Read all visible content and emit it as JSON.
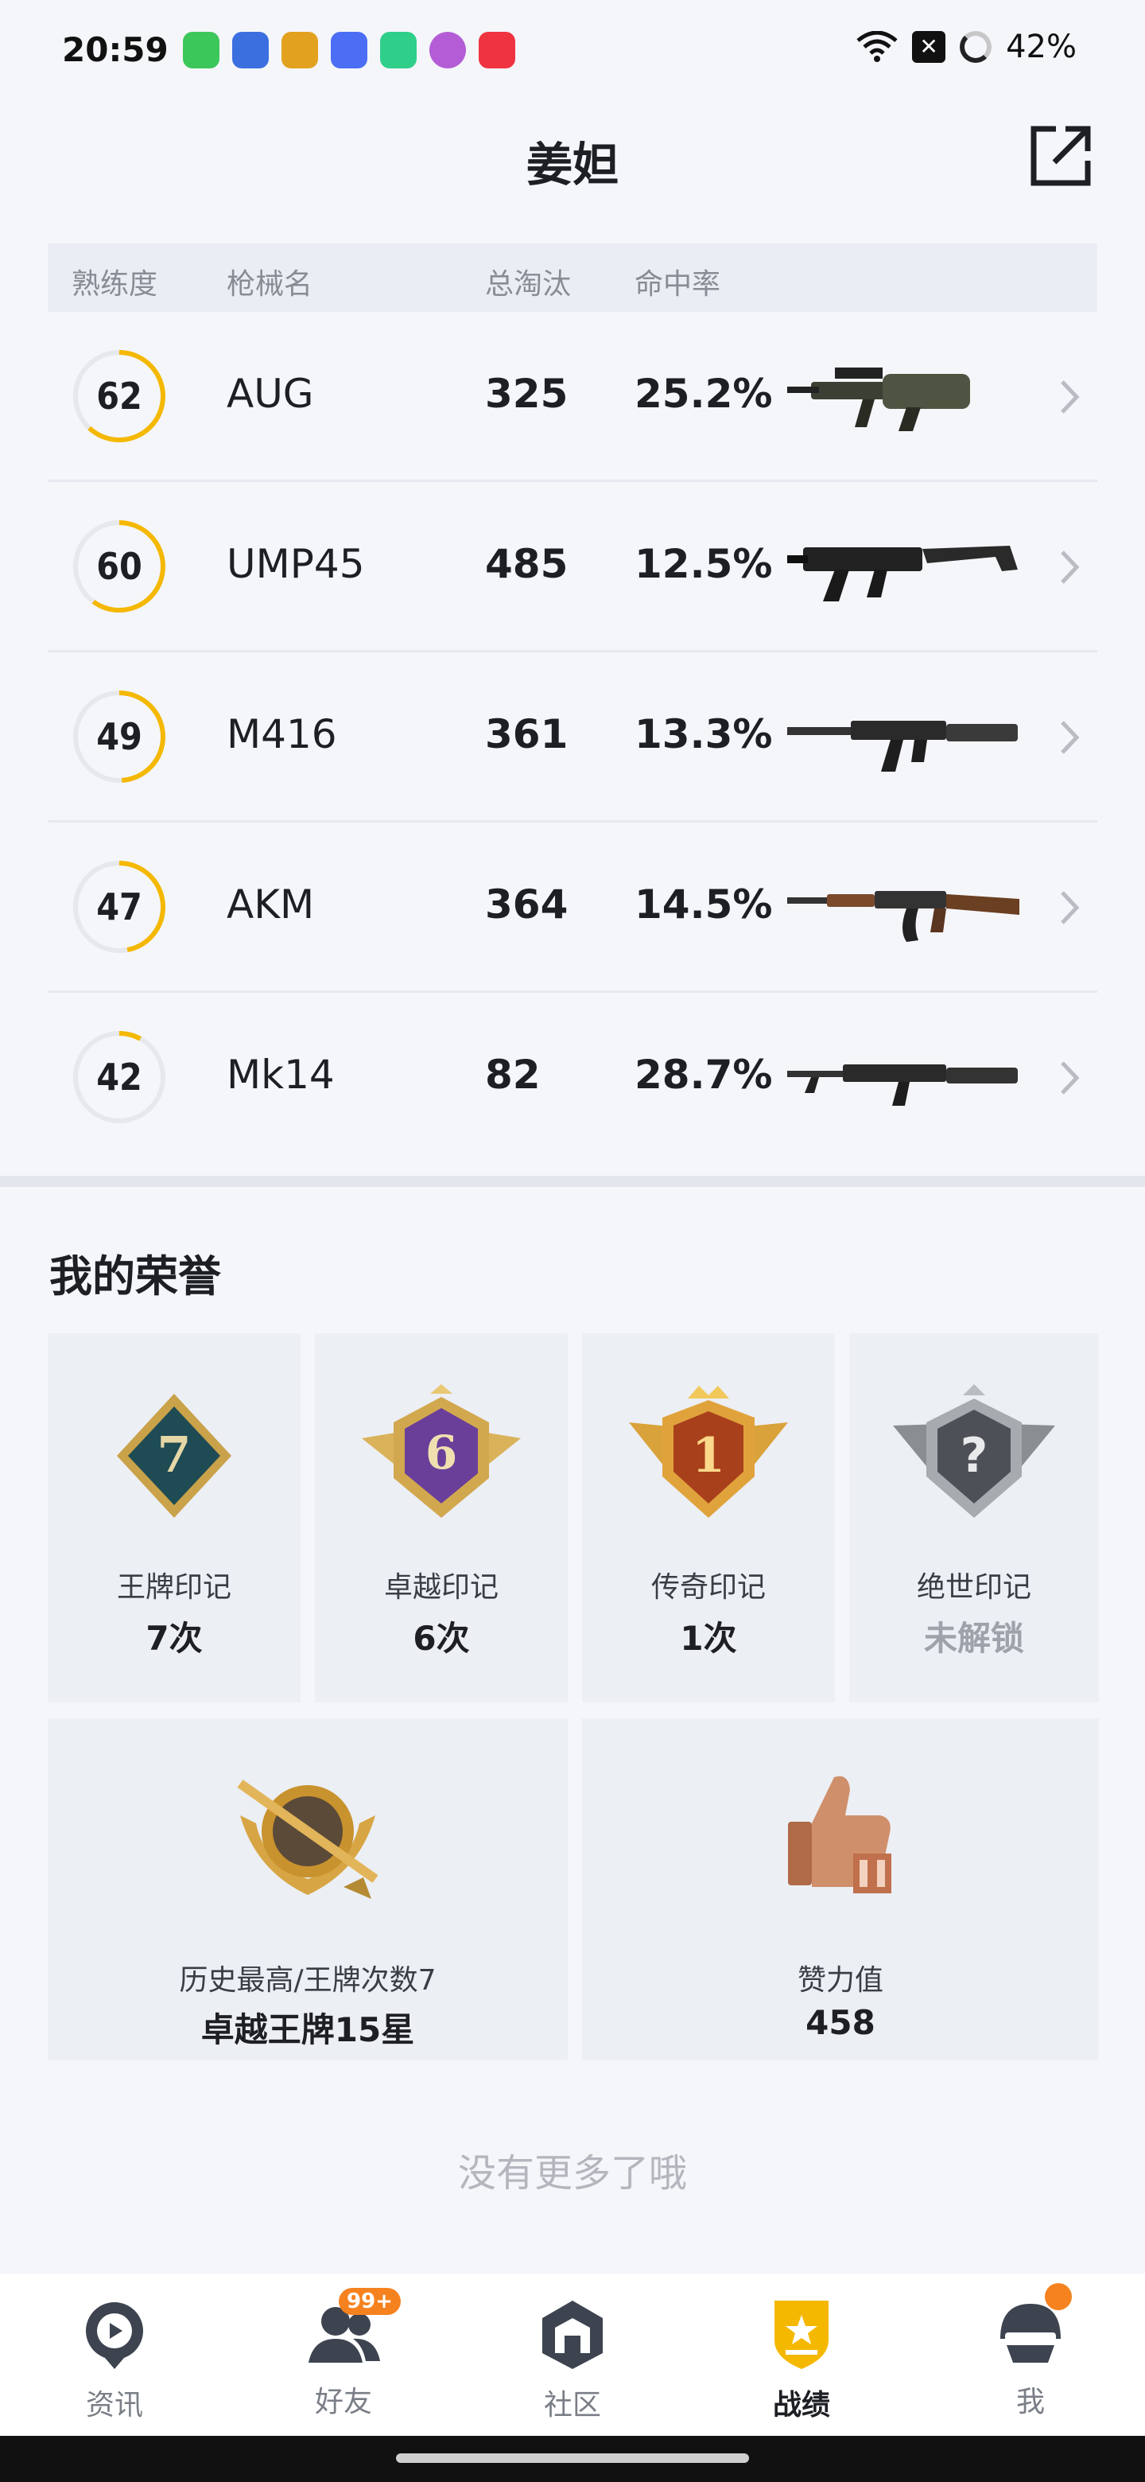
{
  "status_bar": {
    "time": "20:59",
    "battery": "42%"
  },
  "header": {
    "title": "姜妲"
  },
  "table": {
    "headers": [
      "熟练度",
      "枪械名",
      "总淘汰",
      "命中率"
    ],
    "rows": [
      {
        "mastery": "62",
        "name": "AUG",
        "kills": "325",
        "accuracy": "25.2%",
        "progress": 0.62
      },
      {
        "mastery": "60",
        "name": "UMP45",
        "kills": "485",
        "accuracy": "12.5%",
        "progress": 0.6
      },
      {
        "mastery": "49",
        "name": "M416",
        "kills": "361",
        "accuracy": "13.3%",
        "progress": 0.49
      },
      {
        "mastery": "47",
        "name": "AKM",
        "kills": "364",
        "accuracy": "14.5%",
        "progress": 0.47
      },
      {
        "mastery": "42",
        "name": "Mk14",
        "kills": "82",
        "accuracy": "28.7%",
        "progress": 0.08
      }
    ]
  },
  "honor": {
    "title": "我的荣誉",
    "cards": [
      {
        "label": "王牌印记",
        "value": "7次",
        "badge_num": "7"
      },
      {
        "label": "卓越印记",
        "value": "6次",
        "badge_num": "6"
      },
      {
        "label": "传奇印记",
        "value": "1次",
        "badge_num": "1"
      },
      {
        "label": "绝世印记",
        "value": "未解锁",
        "badge_num": "?"
      }
    ],
    "wide_cards": [
      {
        "label": "历史最高/王牌次数7",
        "value": "卓越王牌15星"
      },
      {
        "label": "赞力值",
        "value": "458"
      }
    ]
  },
  "footer_text": "没有更多了哦",
  "nav": {
    "items": [
      {
        "label": "资讯"
      },
      {
        "label": "好友",
        "badge": "99+"
      },
      {
        "label": "社区"
      },
      {
        "label": "战绩"
      },
      {
        "label": "我"
      }
    ]
  },
  "colors": {
    "accent": "#f5b800",
    "ring_track": "#e6e8ec",
    "badge_orange": "#f5821f"
  }
}
